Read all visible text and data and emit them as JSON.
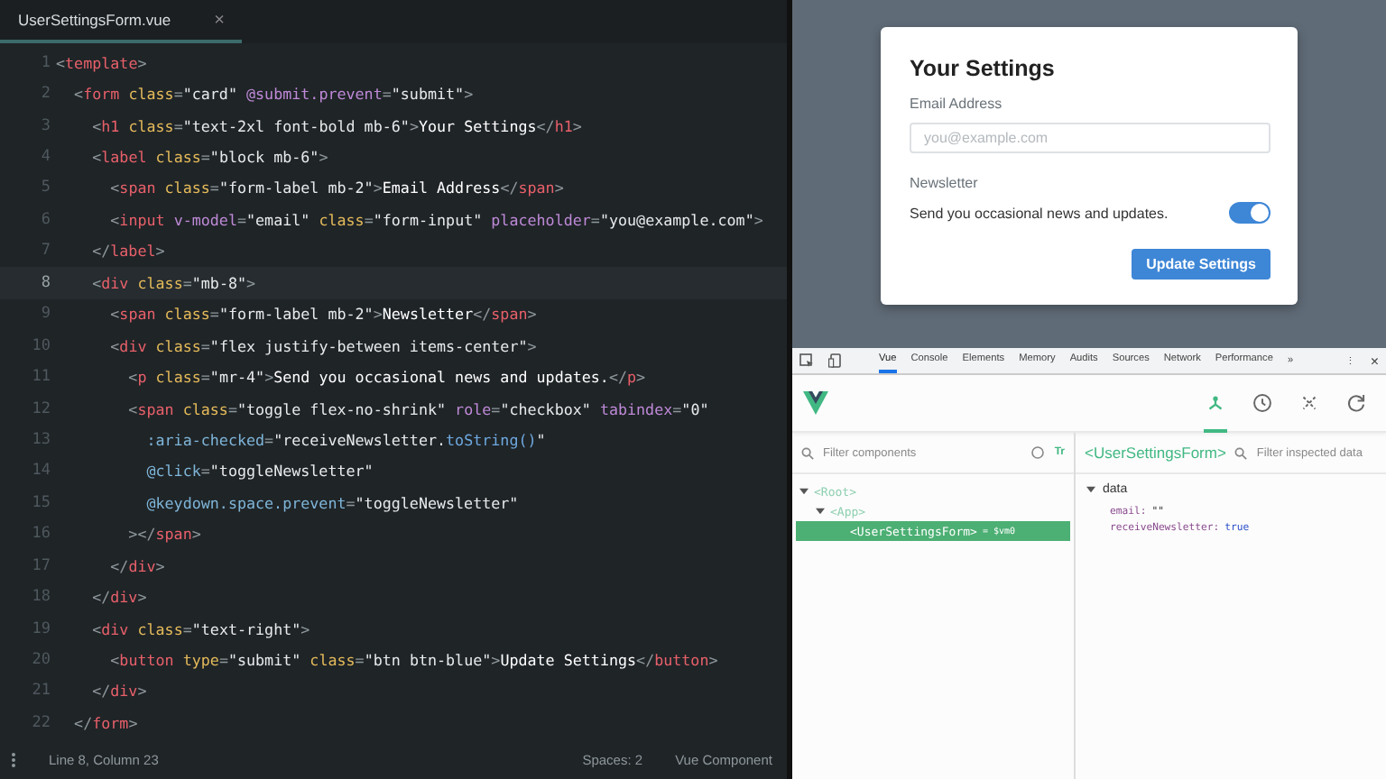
{
  "editor": {
    "tab": {
      "label": "UserSettingsForm.vue",
      "close": "×",
      "selected": true
    },
    "lines": [
      {
        "number": "1",
        "current": false,
        "tokens": [
          {
            "kind": "punct",
            "text": "<"
          },
          {
            "kind": "tag",
            "text": "template"
          },
          {
            "kind": "punct",
            "text": ">"
          }
        ]
      },
      {
        "number": "2",
        "current": false,
        "tokens": [
          {
            "kind": "punct",
            "text": "  <"
          },
          {
            "kind": "tag",
            "text": "form"
          },
          {
            "kind": "attr",
            "text": " class"
          },
          {
            "kind": "punct",
            "text": "="
          },
          {
            "kind": "string",
            "text": "\"card\""
          },
          {
            "kind": "directive",
            "text": " @submit.prevent"
          },
          {
            "kind": "punct",
            "text": "="
          },
          {
            "kind": "string",
            "text": "\"submit\""
          },
          {
            "kind": "punct",
            "text": ">"
          }
        ]
      },
      {
        "number": "3",
        "current": false,
        "tokens": [
          {
            "kind": "punct",
            "text": "    <"
          },
          {
            "kind": "tag",
            "text": "h1"
          },
          {
            "kind": "attr",
            "text": " class"
          },
          {
            "kind": "punct",
            "text": "="
          },
          {
            "kind": "string",
            "text": "\"text-2xl font-bold mb-6\""
          },
          {
            "kind": "punct",
            "text": ">"
          },
          {
            "kind": "text",
            "text": "Your Settings"
          },
          {
            "kind": "punct",
            "text": "</"
          },
          {
            "kind": "tag",
            "text": "h1"
          },
          {
            "kind": "punct",
            "text": ">"
          }
        ]
      },
      {
        "number": "4",
        "current": false,
        "tokens": [
          {
            "kind": "punct",
            "text": "    <"
          },
          {
            "kind": "tag",
            "text": "label"
          },
          {
            "kind": "attr",
            "text": " class"
          },
          {
            "kind": "punct",
            "text": "="
          },
          {
            "kind": "string",
            "text": "\"block mb-6\""
          },
          {
            "kind": "punct",
            "text": ">"
          }
        ]
      },
      {
        "number": "5",
        "current": false,
        "tokens": [
          {
            "kind": "punct",
            "text": "      <"
          },
          {
            "kind": "tag",
            "text": "span"
          },
          {
            "kind": "attr",
            "text": " class"
          },
          {
            "kind": "punct",
            "text": "="
          },
          {
            "kind": "string",
            "text": "\"form-label mb-2\""
          },
          {
            "kind": "punct",
            "text": ">"
          },
          {
            "kind": "text",
            "text": "Email Address"
          },
          {
            "kind": "punct",
            "text": "</"
          },
          {
            "kind": "tag",
            "text": "span"
          },
          {
            "kind": "punct",
            "text": ">"
          }
        ]
      },
      {
        "number": "6",
        "current": false,
        "tokens": [
          {
            "kind": "punct",
            "text": "      <"
          },
          {
            "kind": "tag",
            "text": "input"
          },
          {
            "kind": "directive",
            "text": " v-model"
          },
          {
            "kind": "punct",
            "text": "="
          },
          {
            "kind": "string",
            "text": "\"email\""
          },
          {
            "kind": "attr",
            "text": " class"
          },
          {
            "kind": "punct",
            "text": "="
          },
          {
            "kind": "string",
            "text": "\"form-input\""
          },
          {
            "kind": "directive",
            "text": " placeholder"
          },
          {
            "kind": "punct",
            "text": "="
          },
          {
            "kind": "string",
            "text": "\"you@example.com\""
          },
          {
            "kind": "punct",
            "text": ">"
          }
        ]
      },
      {
        "number": "7",
        "current": false,
        "tokens": [
          {
            "kind": "punct",
            "text": "    </"
          },
          {
            "kind": "tag",
            "text": "label"
          },
          {
            "kind": "punct",
            "text": ">"
          }
        ]
      },
      {
        "number": "8",
        "current": true,
        "tokens": [
          {
            "kind": "punct",
            "text": "    <"
          },
          {
            "kind": "tag",
            "text": "div"
          },
          {
            "kind": "attr",
            "text": " class"
          },
          {
            "kind": "punct",
            "text": "="
          },
          {
            "kind": "string",
            "text": "\"mb-8\""
          },
          {
            "kind": "punct",
            "text": ">"
          }
        ]
      },
      {
        "number": "9",
        "current": false,
        "tokens": [
          {
            "kind": "punct",
            "text": "      <"
          },
          {
            "kind": "tag",
            "text": "span"
          },
          {
            "kind": "attr",
            "text": " class"
          },
          {
            "kind": "punct",
            "text": "="
          },
          {
            "kind": "string",
            "text": "\"form-label mb-2\""
          },
          {
            "kind": "punct",
            "text": ">"
          },
          {
            "kind": "text",
            "text": "Newsletter"
          },
          {
            "kind": "punct",
            "text": "</"
          },
          {
            "kind": "tag",
            "text": "span"
          },
          {
            "kind": "punct",
            "text": ">"
          }
        ]
      },
      {
        "number": "10",
        "current": false,
        "tokens": [
          {
            "kind": "punct",
            "text": "      <"
          },
          {
            "kind": "tag",
            "text": "div"
          },
          {
            "kind": "attr",
            "text": " class"
          },
          {
            "kind": "punct",
            "text": "="
          },
          {
            "kind": "string",
            "text": "\"flex justify-between items-center\""
          },
          {
            "kind": "punct",
            "text": ">"
          }
        ]
      },
      {
        "number": "11",
        "current": false,
        "tokens": [
          {
            "kind": "punct",
            "text": "        <"
          },
          {
            "kind": "tag",
            "text": "p"
          },
          {
            "kind": "attr",
            "text": " class"
          },
          {
            "kind": "punct",
            "text": "="
          },
          {
            "kind": "string",
            "text": "\"mr-4\""
          },
          {
            "kind": "punct",
            "text": ">"
          },
          {
            "kind": "text",
            "text": "Send you occasional news and updates."
          },
          {
            "kind": "punct",
            "text": "</"
          },
          {
            "kind": "tag",
            "text": "p"
          },
          {
            "kind": "punct",
            "text": ">"
          }
        ]
      },
      {
        "number": "12",
        "current": false,
        "tokens": [
          {
            "kind": "punct",
            "text": "        <"
          },
          {
            "kind": "tag",
            "text": "span"
          },
          {
            "kind": "attr",
            "text": " class"
          },
          {
            "kind": "punct",
            "text": "="
          },
          {
            "kind": "string",
            "text": "\"toggle flex-no-shrink\""
          },
          {
            "kind": "directive",
            "text": " role"
          },
          {
            "kind": "punct",
            "text": "="
          },
          {
            "kind": "string",
            "text": "\"checkbox\""
          },
          {
            "kind": "directive",
            "text": " tabindex"
          },
          {
            "kind": "punct",
            "text": "="
          },
          {
            "kind": "string",
            "text": "\"0\""
          }
        ]
      },
      {
        "number": "13",
        "current": false,
        "tokens": [
          {
            "kind": "event",
            "text": "          :aria-checked"
          },
          {
            "kind": "punct",
            "text": "="
          },
          {
            "kind": "string",
            "text": "\"receiveNewsletter."
          },
          {
            "kind": "method",
            "text": "toString()"
          },
          {
            "kind": "string",
            "text": "\""
          }
        ]
      },
      {
        "number": "14",
        "current": false,
        "tokens": [
          {
            "kind": "event",
            "text": "          @click"
          },
          {
            "kind": "punct",
            "text": "="
          },
          {
            "kind": "string",
            "text": "\"toggleNewsletter\""
          }
        ]
      },
      {
        "number": "15",
        "current": false,
        "tokens": [
          {
            "kind": "event",
            "text": "          @keydown.space.prevent"
          },
          {
            "kind": "punct",
            "text": "="
          },
          {
            "kind": "string",
            "text": "\"toggleNewsletter\""
          }
        ]
      },
      {
        "number": "16",
        "current": false,
        "tokens": [
          {
            "kind": "punct",
            "text": "        ></"
          },
          {
            "kind": "tag",
            "text": "span"
          },
          {
            "kind": "punct",
            "text": ">"
          }
        ]
      },
      {
        "number": "17",
        "current": false,
        "tokens": [
          {
            "kind": "punct",
            "text": "      </"
          },
          {
            "kind": "tag",
            "text": "div"
          },
          {
            "kind": "punct",
            "text": ">"
          }
        ]
      },
      {
        "number": "18",
        "current": false,
        "tokens": [
          {
            "kind": "punct",
            "text": "    </"
          },
          {
            "kind": "tag",
            "text": "div"
          },
          {
            "kind": "punct",
            "text": ">"
          }
        ]
      },
      {
        "number": "19",
        "current": false,
        "tokens": [
          {
            "kind": "punct",
            "text": "    <"
          },
          {
            "kind": "tag",
            "text": "div"
          },
          {
            "kind": "attr",
            "text": " class"
          },
          {
            "kind": "punct",
            "text": "="
          },
          {
            "kind": "string",
            "text": "\"text-right\""
          },
          {
            "kind": "punct",
            "text": ">"
          }
        ]
      },
      {
        "number": "20",
        "current": false,
        "tokens": [
          {
            "kind": "punct",
            "text": "      <"
          },
          {
            "kind": "tag",
            "text": "button"
          },
          {
            "kind": "attr",
            "text": " type"
          },
          {
            "kind": "punct",
            "text": "="
          },
          {
            "kind": "string",
            "text": "\"submit\""
          },
          {
            "kind": "attr",
            "text": " class"
          },
          {
            "kind": "punct",
            "text": "="
          },
          {
            "kind": "string",
            "text": "\"btn btn-blue\""
          },
          {
            "kind": "punct",
            "text": ">"
          },
          {
            "kind": "text",
            "text": "Update Settings"
          },
          {
            "kind": "punct",
            "text": "</"
          },
          {
            "kind": "tag",
            "text": "button"
          },
          {
            "kind": "punct",
            "text": ">"
          }
        ]
      },
      {
        "number": "21",
        "current": false,
        "tokens": [
          {
            "kind": "punct",
            "text": "    </"
          },
          {
            "kind": "tag",
            "text": "div"
          },
          {
            "kind": "punct",
            "text": ">"
          }
        ]
      },
      {
        "number": "22",
        "current": false,
        "tokens": [
          {
            "kind": "punct",
            "text": "  </"
          },
          {
            "kind": "tag",
            "text": "form"
          },
          {
            "kind": "punct",
            "text": ">"
          }
        ]
      }
    ],
    "status_bar": {
      "position": "Line 8, Column 23",
      "indent": "Spaces: 2",
      "language": "Vue Component"
    }
  },
  "preview": {
    "title": "Your Settings",
    "email_label": "Email Address",
    "email_placeholder": "you@example.com",
    "newsletter_label": "Newsletter",
    "newsletter_text": "Send you occasional news and updates.",
    "newsletter_on": true,
    "button": "Update Settings"
  },
  "devtools": {
    "tabs": [
      {
        "label": "Vue",
        "selected": true
      },
      {
        "label": "Console",
        "selected": false
      },
      {
        "label": "Elements",
        "selected": false
      },
      {
        "label": "Memory",
        "selected": false
      },
      {
        "label": "Audits",
        "selected": false
      },
      {
        "label": "Sources",
        "selected": false
      },
      {
        "label": "Network",
        "selected": false
      },
      {
        "label": "Performance",
        "selected": false
      }
    ],
    "more": "»",
    "menu": "⋮",
    "close": "×",
    "filter_placeholder": "Filter components",
    "text_toggle": "Tr",
    "tree": [
      {
        "name": "<Root>",
        "expanded": true,
        "selected": false,
        "children": [
          {
            "name": "<App>",
            "expanded": true,
            "selected": false,
            "children": [
              {
                "name": "<UserSettingsForm>",
                "selected": true,
                "ref": "= $vm0"
              }
            ]
          }
        ]
      }
    ],
    "inspector": {
      "component": "<UserSettingsForm>",
      "filter_placeholder": "Filter inspected data",
      "section": "data",
      "expanded": true,
      "fields": [
        {
          "key": "email:",
          "value": "\"\""
        },
        {
          "key": "receiveNewsletter:",
          "value": "true"
        }
      ]
    }
  }
}
